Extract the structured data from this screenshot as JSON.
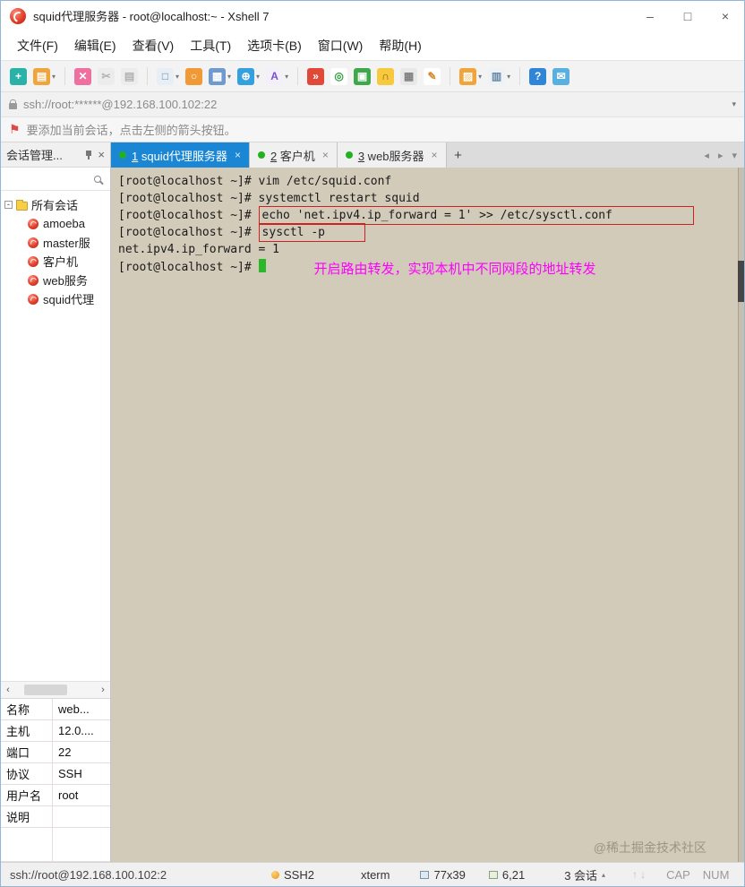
{
  "window": {
    "title": "squid代理服务器 - root@localhost:~ - Xshell 7",
    "controls": {
      "minimize": "–",
      "maximize": "□",
      "close": "×"
    }
  },
  "menu": {
    "items": [
      "文件(F)",
      "编辑(E)",
      "查看(V)",
      "工具(T)",
      "选项卡(B)",
      "窗口(W)",
      "帮助(H)"
    ]
  },
  "toolbar": {
    "icons": [
      {
        "name": "new-session-icon",
        "glyph": "+",
        "bg": "#29b2a8",
        "fg": "#ffffff"
      },
      {
        "name": "open-folder-icon",
        "glyph": "▤",
        "bg": "#f0a43c",
        "fg": "#ffffff",
        "dropdown": true
      },
      {
        "separator": true
      },
      {
        "name": "disconnect-icon",
        "glyph": "✕",
        "bg": "#ef6f9f",
        "fg": "#ffffff"
      },
      {
        "name": "cut-icon",
        "glyph": "✂",
        "bg": "#ececec",
        "fg": "#b0b0b0"
      },
      {
        "name": "paste-icon",
        "glyph": "▤",
        "bg": "#ececec",
        "fg": "#b0b0b0"
      },
      {
        "separator": true
      },
      {
        "name": "new-window-icon",
        "glyph": "□",
        "bg": "#e8eef5",
        "fg": "#6a88a8",
        "dropdown": true
      },
      {
        "name": "find-icon",
        "glyph": "○",
        "bg": "#f09a36",
        "fg": "#ffffff"
      },
      {
        "name": "session-properties-icon",
        "glyph": "▦",
        "bg": "#6f9ad0",
        "fg": "#ffffff",
        "dropdown": true
      },
      {
        "name": "web-browser-icon",
        "glyph": "⊕",
        "bg": "#35a0e0",
        "fg": "#ffffff",
        "dropdown": true
      },
      {
        "name": "font-icon",
        "glyph": "A",
        "bg": "#f4f0fa",
        "fg": "#7a4fd0",
        "dropdown": true
      },
      {
        "separator": true
      },
      {
        "name": "quick-command-icon",
        "glyph": "»",
        "bg": "#e04838",
        "fg": "#ffffff"
      },
      {
        "name": "record-icon",
        "glyph": "◎",
        "bg": "#ffffff",
        "fg": "#2f9f3f"
      },
      {
        "name": "fullscreen-icon",
        "glyph": "▣",
        "bg": "#3fa84a",
        "fg": "#ffffff"
      },
      {
        "name": "lock-icon",
        "glyph": "∩",
        "bg": "#f6c93e",
        "fg": "#7a5a10"
      },
      {
        "name": "keyboard-icon",
        "glyph": "▦",
        "bg": "#e8e8e8",
        "fg": "#808080"
      },
      {
        "name": "highlighter-icon",
        "glyph": "✎",
        "bg": "#ffffff",
        "fg": "#d8882a"
      },
      {
        "separator": true
      },
      {
        "name": "new-folder-icon",
        "glyph": "▨",
        "bg": "#f0a43c",
        "fg": "#ffffff",
        "dropdown": true
      },
      {
        "name": "layout-icon",
        "glyph": "▥",
        "bg": "#eef2f6",
        "fg": "#6a88a8",
        "dropdown": true
      },
      {
        "separator": true
      },
      {
        "name": "help-icon",
        "glyph": "?",
        "bg": "#2f86d8",
        "fg": "#ffffff"
      },
      {
        "name": "feedback-icon",
        "glyph": "✉",
        "bg": "#58b0e0",
        "fg": "#ffffff"
      }
    ]
  },
  "address_bar": {
    "value": "ssh://root:******@192.168.100.102:22",
    "caret": "▾"
  },
  "info_bar": {
    "flag": "⚑",
    "text": "要添加当前会话，点击左侧的箭头按钮。"
  },
  "sidebar": {
    "title": "会话管理...",
    "close": "×",
    "search_value": "",
    "tree": {
      "expander": "-",
      "root": "所有会话",
      "items": [
        "amoeba",
        "master服",
        "客户机",
        "web服务",
        "squid代理"
      ]
    },
    "hscroll": {
      "prev": "‹",
      "next": "›"
    },
    "properties": [
      {
        "label": "名称",
        "value": "web..."
      },
      {
        "label": "主机",
        "value": "12.0...."
      },
      {
        "label": "端口",
        "value": "22"
      },
      {
        "label": "协议",
        "value": "SSH"
      },
      {
        "label": "用户名",
        "value": "root"
      },
      {
        "label": "说明",
        "value": ""
      }
    ]
  },
  "tabs": {
    "items": [
      {
        "label": "1 squid代理服务器",
        "active": true,
        "close": "×"
      },
      {
        "label": "2 客户机",
        "active": false,
        "close": "×"
      },
      {
        "label": "3 web服务器",
        "active": false,
        "close": "×"
      }
    ],
    "new_tab": "+",
    "nav": {
      "prev": "◂",
      "next": "▸",
      "menu": "▾"
    }
  },
  "terminal": {
    "lines": [
      {
        "text": "[root@localhost ~]# vim /etc/squid.conf"
      },
      {
        "text": "[root@localhost ~]# systemctl restart squid"
      },
      {
        "prefix": "[root@localhost ~]# ",
        "boxed": "echo 'net.ipv4.ip_forward = 1' >> /etc/sysctl.conf",
        "box_pad": "lg"
      },
      {
        "prefix": "[root@localhost ~]# ",
        "boxed": "sysctl -p",
        "box_pad": "sm"
      },
      {
        "text": "net.ipv4.ip_forward = 1"
      },
      {
        "prefix": "[root@localhost ~]# ",
        "cursor": true,
        "annotation": "开启路由转发，实现本机中不同网段的地址转发"
      }
    ],
    "watermark": "@稀土掘金技术社区"
  },
  "status_bar": {
    "url": "ssh://root@192.168.100.102:2",
    "protocol": "SSH2",
    "terminal_type": "xterm",
    "screen_size": "77x39",
    "cursor_position": "6,21",
    "session_count": "3 会话",
    "session_tri": "▴",
    "arrows": "↑↓",
    "cap": "CAP",
    "num": "NUM"
  }
}
